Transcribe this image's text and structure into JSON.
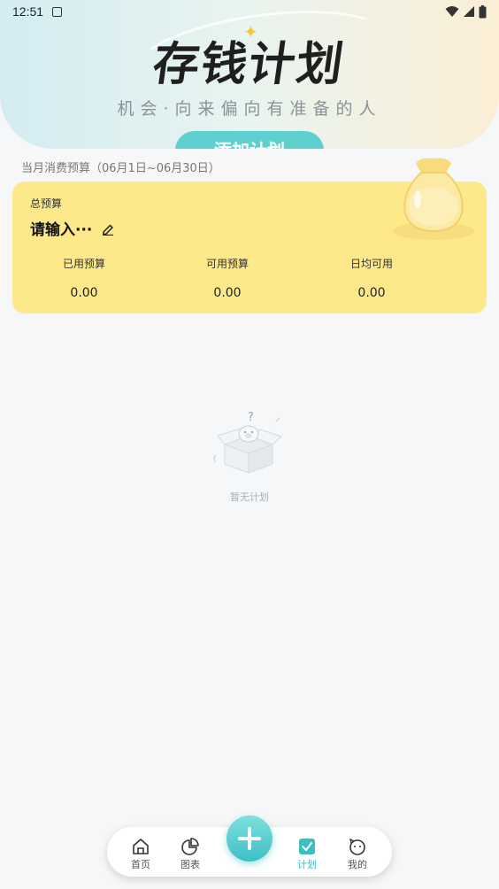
{
  "status_bar": {
    "time": "12:51"
  },
  "banner": {
    "title": "存钱计划",
    "subtitle": "机会·向来偏向有准备的人",
    "button_label": "添加计划"
  },
  "budget": {
    "period_label": "当月消费预算（06月1日~06月30日）",
    "title": "总预算",
    "input_placeholder": "请输入···",
    "stats": [
      {
        "label": "已用预算",
        "value": "0.00"
      },
      {
        "label": "可用预算",
        "value": "0.00"
      },
      {
        "label": "日均可用",
        "value": "0.00"
      }
    ]
  },
  "empty_state": {
    "text": "暂无计划"
  },
  "bottom_nav": {
    "items": [
      {
        "label": "首页",
        "icon": "home-icon"
      },
      {
        "label": "图表",
        "icon": "pie-chart-icon"
      },
      {
        "label": "计划",
        "icon": "plan-check-icon",
        "active": true
      },
      {
        "label": "我的",
        "icon": "pig-face-icon"
      }
    ],
    "fab_icon": "plus-icon",
    "accent_color": "#3bbfc3"
  },
  "colors": {
    "card_background": "#fde98a",
    "accent": "#5fd0d0"
  }
}
